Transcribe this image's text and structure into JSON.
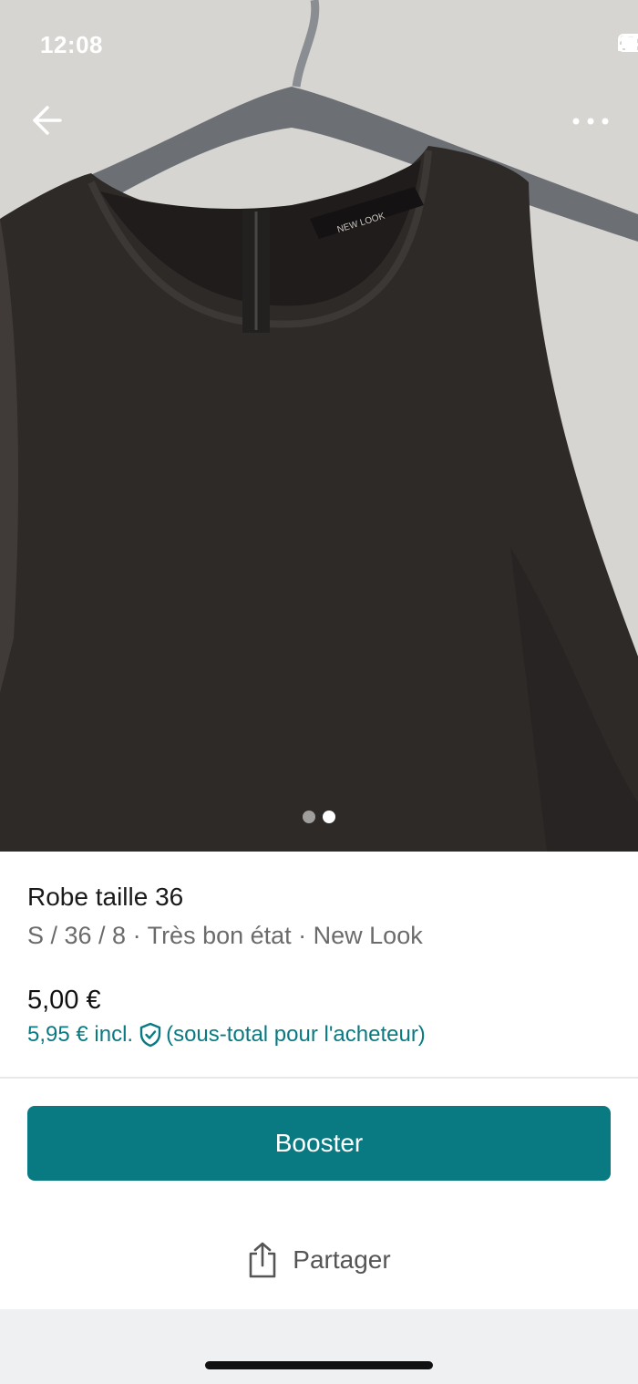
{
  "status_bar": {
    "time": "12:08"
  },
  "photo": {
    "image_count": 2,
    "active_index": 1,
    "label_text": "NEW LOOK"
  },
  "nav": {
    "back_icon": "arrow-left-icon",
    "more_icon": "more-horizontal-icon"
  },
  "listing": {
    "title": "Robe taille 36",
    "subtitle": "S / 36 / 8 · Très bon état · New Look",
    "price": "5,00 €",
    "price_incl_amount": "5,95 € incl.",
    "price_incl_note": "(sous-total pour l'acheteur)"
  },
  "actions": {
    "booster_label": "Booster",
    "share_label": "Partager"
  },
  "colors": {
    "accent": "#0a7a82",
    "text_primary": "#1a1a1a",
    "text_secondary": "#6b6b6b"
  }
}
